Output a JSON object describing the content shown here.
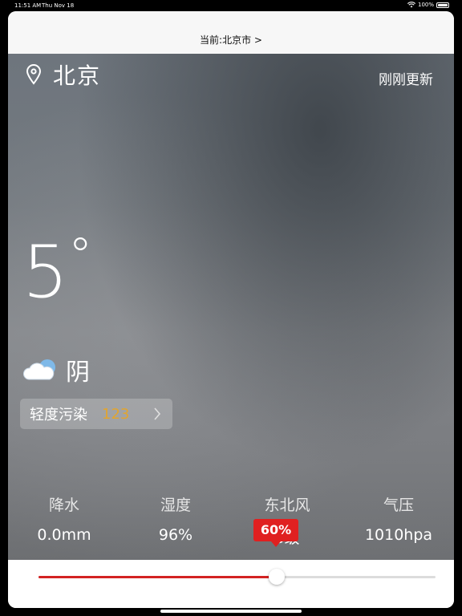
{
  "status_bar": {
    "time": "11:51 AM",
    "date": "Thu Nov 18",
    "battery": "100%"
  },
  "nav": {
    "title": "当前:北京市 >"
  },
  "weather": {
    "city": "北京",
    "updated": "刚刚更新",
    "temperature": "5",
    "degree_symbol": "°",
    "condition": "阴",
    "aqi": {
      "label": "轻度污染",
      "value": "123"
    },
    "stats": [
      {
        "label": "降水",
        "value": "0.0mm"
      },
      {
        "label": "湿度",
        "value": "96%"
      },
      {
        "label": "东北风",
        "value": "3级"
      },
      {
        "label": "气压",
        "value": "1010hpa"
      }
    ]
  },
  "player": {
    "progress_label": "60%",
    "progress": 0.6,
    "accent_color": "#d32222"
  },
  "icons": [
    "location-pin-icon",
    "cloud-icon",
    "chevron-right-icon",
    "wifi-icon",
    "battery-icon"
  ]
}
